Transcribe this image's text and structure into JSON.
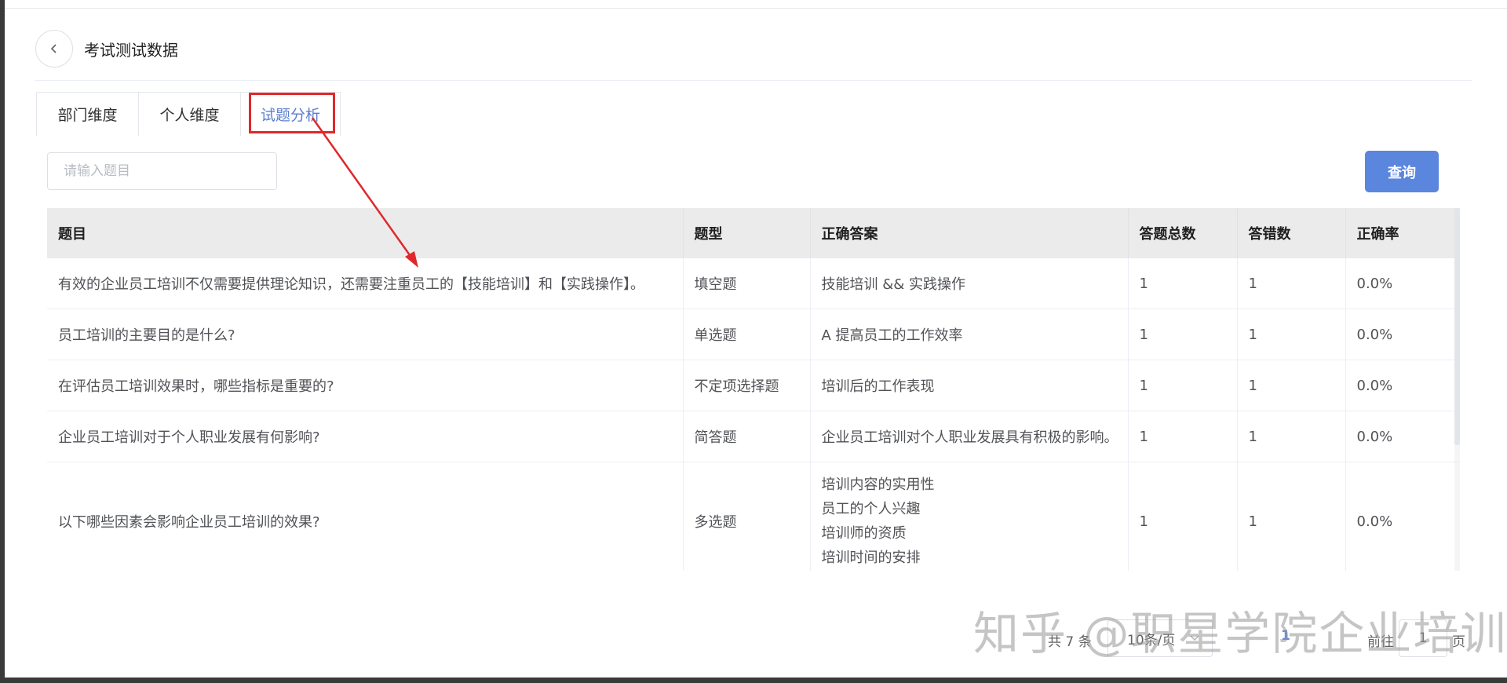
{
  "header": {
    "title": "考试测试数据"
  },
  "tabs": [
    {
      "label": "部门维度"
    },
    {
      "label": "个人维度"
    },
    {
      "label": "试题分析",
      "active": true
    }
  ],
  "search": {
    "placeholder": "请输入题目",
    "value": ""
  },
  "query_button": {
    "label": "查询"
  },
  "table": {
    "columns": [
      "题目",
      "题型",
      "正确答案",
      "答题总数",
      "答错数",
      "正确率"
    ],
    "rows": [
      {
        "question": "有效的企业员工培训不仅需要提供理论知识，还需要注重员工的【技能培训】和【实践操作】。",
        "type": "填空题",
        "answer": [
          "技能培训 && 实践操作"
        ],
        "total": "1",
        "wrong": "1",
        "rate": "0.0%"
      },
      {
        "question": "员工培训的主要目的是什么?",
        "type": "单选题",
        "answer": [
          "A 提高员工的工作效率"
        ],
        "total": "1",
        "wrong": "1",
        "rate": "0.0%"
      },
      {
        "question": "在评估员工培训效果时，哪些指标是重要的?",
        "type": "不定项选择题",
        "answer": [
          "培训后的工作表现"
        ],
        "total": "1",
        "wrong": "1",
        "rate": "0.0%"
      },
      {
        "question": "企业员工培训对于个人职业发展有何影响?",
        "type": "简答题",
        "answer": [
          "企业员工培训对个人职业发展具有积极的影响。"
        ],
        "total": "1",
        "wrong": "1",
        "rate": "0.0%"
      },
      {
        "question": "以下哪些因素会影响企业员工培训的效果?",
        "type": "多选题",
        "answer": [
          "培训内容的实用性",
          "员工的个人兴趣",
          "培训师的资质",
          "培训时间的安排"
        ],
        "total": "1",
        "wrong": "1",
        "rate": "0.0%"
      }
    ]
  },
  "pagination": {
    "total_text": "共 7 条",
    "page_size_text": "10条/页",
    "current_page": "1",
    "goto_label": "前往",
    "goto_value": "1",
    "goto_suffix": "页"
  },
  "watermark": {
    "text": "知乎 @职星学院企业培训"
  },
  "colors": {
    "accent": "#5b86dd",
    "annotation": "#e0282b",
    "header_bg": "#ebebeb"
  }
}
